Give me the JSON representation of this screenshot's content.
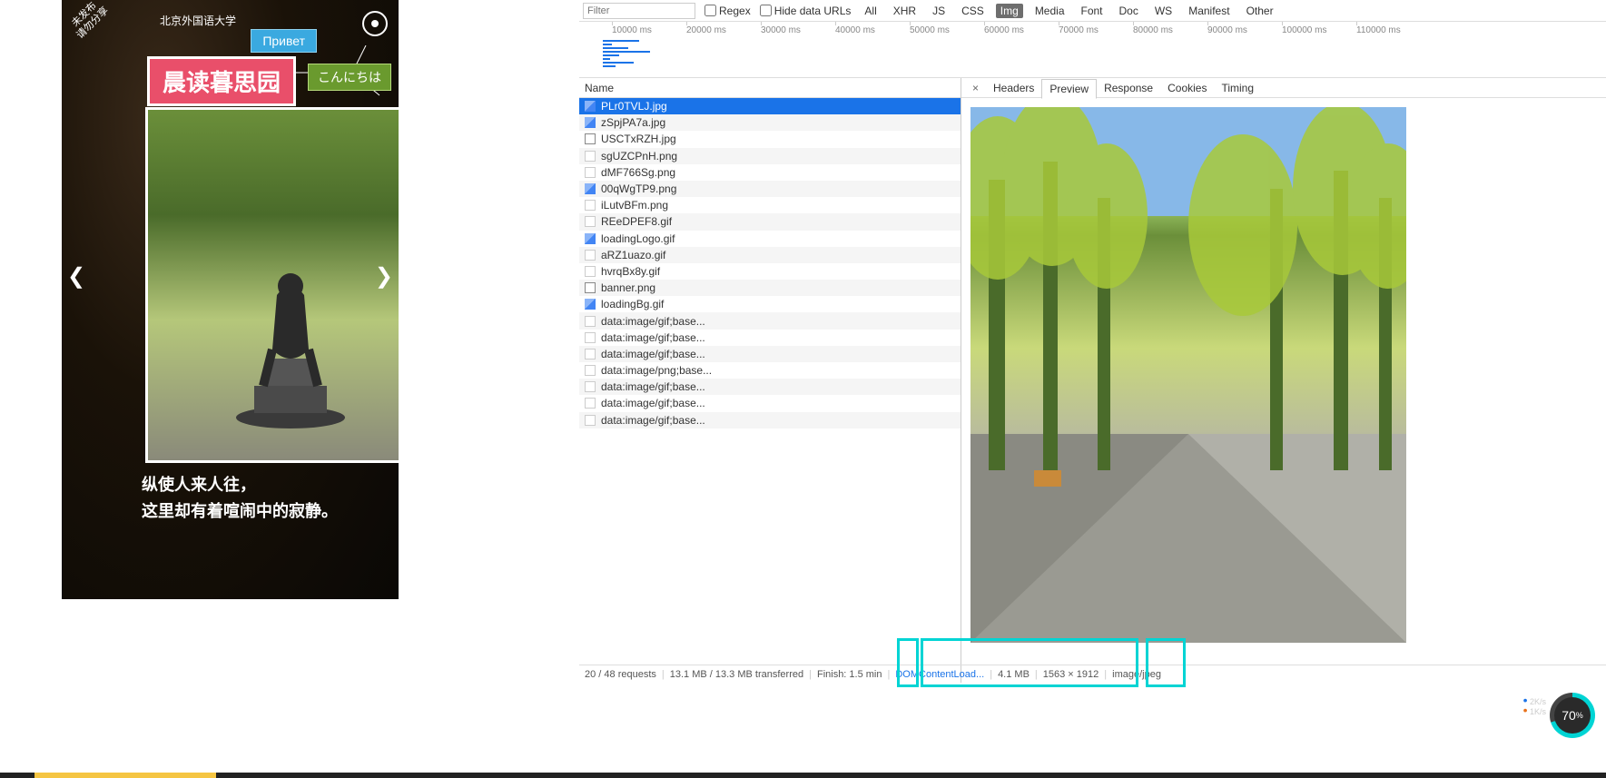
{
  "phone": {
    "ribbon_line1": "未发布",
    "ribbon_line2": "请勿分享",
    "university": "北京外国语大学",
    "bubble_ru": "Привет",
    "bubble_jp": "こんにちは",
    "title": "晨读暮思园",
    "caption_line1": "纵使人来人往，",
    "caption_line2": "这里却有着喧闹中的寂静。"
  },
  "devtools": {
    "filter_placeholder": "Filter",
    "regex_label": "Regex",
    "hide_label": "Hide data URLs",
    "types": [
      "All",
      "XHR",
      "JS",
      "CSS",
      "Img",
      "Media",
      "Font",
      "Doc",
      "WS",
      "Manifest",
      "Other"
    ],
    "active_type": "Img",
    "timeline_ticks": [
      "10000 ms",
      "20000 ms",
      "30000 ms",
      "40000 ms",
      "50000 ms",
      "60000 ms",
      "70000 ms",
      "80000 ms",
      "90000 ms",
      "100000 ms",
      "110000 ms"
    ],
    "name_header": "Name",
    "files": [
      {
        "name": "PLr0TVLJ.jpg",
        "icon": "img",
        "selected": true
      },
      {
        "name": "zSpjPA7a.jpg",
        "icon": "img"
      },
      {
        "name": "USCTxRZH.jpg",
        "icon": "imgw"
      },
      {
        "name": "sgUZCPnH.png",
        "icon": "blank"
      },
      {
        "name": "dMF766Sg.png",
        "icon": "blank"
      },
      {
        "name": "00qWgTP9.png",
        "icon": "img"
      },
      {
        "name": "iLutvBFm.png",
        "icon": "blank"
      },
      {
        "name": "REeDPEF8.gif",
        "icon": "blank"
      },
      {
        "name": "loadingLogo.gif",
        "icon": "img"
      },
      {
        "name": "aRZ1uazo.gif",
        "icon": "blank"
      },
      {
        "name": "hvrqBx8y.gif",
        "icon": "blank"
      },
      {
        "name": "banner.png",
        "icon": "imgw"
      },
      {
        "name": "loadingBg.gif",
        "icon": "img"
      },
      {
        "name": "data:image/gif;base...",
        "icon": "blank"
      },
      {
        "name": "data:image/gif;base...",
        "icon": "blank"
      },
      {
        "name": "data:image/gif;base...",
        "icon": "blank"
      },
      {
        "name": "data:image/png;base...",
        "icon": "blank"
      },
      {
        "name": "data:image/gif;base...",
        "icon": "blank"
      },
      {
        "name": "data:image/gif;base...",
        "icon": "blank"
      },
      {
        "name": "data:image/gif;base...",
        "icon": "blank"
      }
    ],
    "detail_tabs": [
      "Headers",
      "Preview",
      "Response",
      "Cookies",
      "Timing"
    ],
    "active_detail_tab": "Preview",
    "status": {
      "requests": "20 / 48 requests",
      "transferred": "13.1 MB / 13.3 MB transferred",
      "finish": "Finish: 1.5 min",
      "domload": "DOMContentLoad...",
      "size": "4.1 MB",
      "dims": "1563 × 1912",
      "mime": "image/jpeg"
    }
  },
  "gauge": {
    "up": "2K/s",
    "down": "1K/s",
    "percent": "70",
    "percent_suffix": "%"
  }
}
